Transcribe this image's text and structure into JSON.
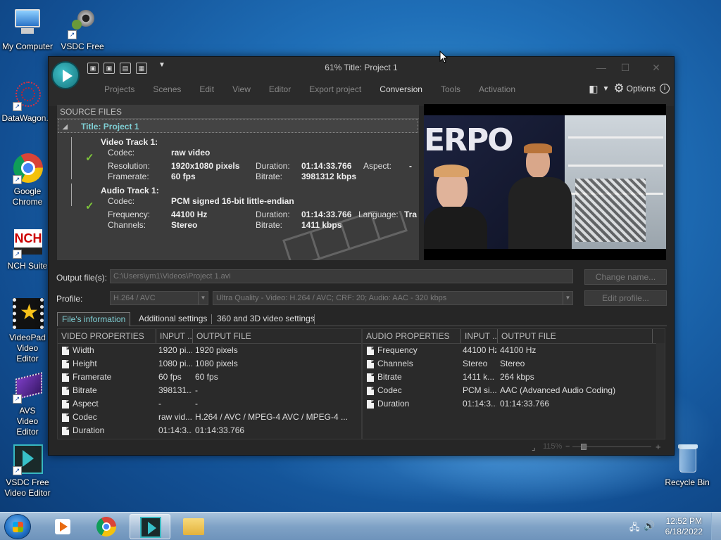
{
  "desktop": {
    "icons": [
      {
        "label": "My Computer"
      },
      {
        "label": "VSDC Free Video C..."
      },
      {
        "label": "DataWagon..."
      },
      {
        "label": "Google Chrome"
      },
      {
        "label": "NCH Suite"
      },
      {
        "label": "VideoPad Video Editor"
      },
      {
        "label": "AVS Video Editor"
      },
      {
        "label": "VSDC Free Video Editor"
      },
      {
        "label": "Recycle Bin"
      }
    ]
  },
  "window": {
    "title": "61% Title: Project 1",
    "menu": [
      "Projects",
      "Scenes",
      "Edit",
      "View",
      "Editor",
      "Export project",
      "Conversion",
      "Tools",
      "Activation"
    ],
    "active_menu": "Conversion",
    "options_label": "Options"
  },
  "source_files": {
    "header": "SOURCE FILES",
    "project_title": "Title: Project 1",
    "video_track": {
      "heading": "Video Track 1:",
      "codec_label": "Codec:",
      "codec": "raw video",
      "resolution_label": "Resolution:",
      "resolution": "1920x1080 pixels",
      "duration_label": "Duration:",
      "duration": "01:14:33.766",
      "aspect_label": "Aspect:",
      "aspect": "-",
      "framerate_label": "Framerate:",
      "framerate": "60 fps",
      "bitrate_label": "Bitrate:",
      "bitrate": "3981312 kbps"
    },
    "audio_track": {
      "heading": "Audio Track 1:",
      "codec_label": "Codec:",
      "codec": "PCM signed 16-bit little-endian",
      "frequency_label": "Frequency:",
      "frequency": "44100 Hz",
      "duration_label": "Duration:",
      "duration": "01:14:33.766",
      "language_label": "Language:",
      "language": "Tra",
      "channels_label": "Channels:",
      "channels": "Stereo",
      "bitrate_label": "Bitrate:",
      "bitrate": "1411 kbps"
    }
  },
  "preview": {
    "overlay_text": "ERPO"
  },
  "output": {
    "output_label": "Output file(s):",
    "output_path": "C:\\Users\\ym1\\Videos\\Project 1.avi",
    "change_name": "Change name...",
    "profile_label": "Profile:",
    "profile_value": "H.264 / AVC",
    "profile_desc": "Ultra Quality - Video: H.264 / AVC; CRF: 20; Audio: AAC - 320 kbps",
    "edit_profile": "Edit profile..."
  },
  "tabs": [
    "File's information",
    "Additional settings",
    "360 and 3D video settings"
  ],
  "video_props": {
    "headers": [
      "VIDEO PROPERTIES",
      "INPUT ...",
      "OUTPUT FILE"
    ],
    "rows": [
      [
        "Width",
        "1920 pi...",
        "1920 pixels"
      ],
      [
        "Height",
        "1080 pi...",
        "1080 pixels"
      ],
      [
        "Framerate",
        "60 fps",
        "60 fps"
      ],
      [
        "Bitrate",
        "398131...",
        "-"
      ],
      [
        "Aspect",
        "-",
        "-"
      ],
      [
        "Codec",
        "raw vid...",
        "H.264 / AVC / MPEG-4 AVC / MPEG-4 ..."
      ],
      [
        "Duration",
        "01:14:3...",
        "01:14:33.766"
      ]
    ]
  },
  "audio_props": {
    "headers": [
      "AUDIO PROPERTIES",
      "INPUT ...",
      "OUTPUT FILE"
    ],
    "rows": [
      [
        "Frequency",
        "44100 Hz",
        "44100 Hz"
      ],
      [
        "Channels",
        "Stereo",
        "Stereo"
      ],
      [
        "Bitrate",
        "1411 k...",
        "264 kbps"
      ],
      [
        "Codec",
        "PCM si...",
        "AAC (Advanced Audio Coding)"
      ],
      [
        "Duration",
        "01:14:3...",
        "01:14:33.766"
      ]
    ]
  },
  "zoom": {
    "value": "115%"
  },
  "taskbar": {
    "time": "12:52 PM",
    "date": "6/18/2022"
  },
  "colors": {
    "accent": "#7fcfd4",
    "window_bg": "#262626",
    "check": "#7ec63a"
  }
}
